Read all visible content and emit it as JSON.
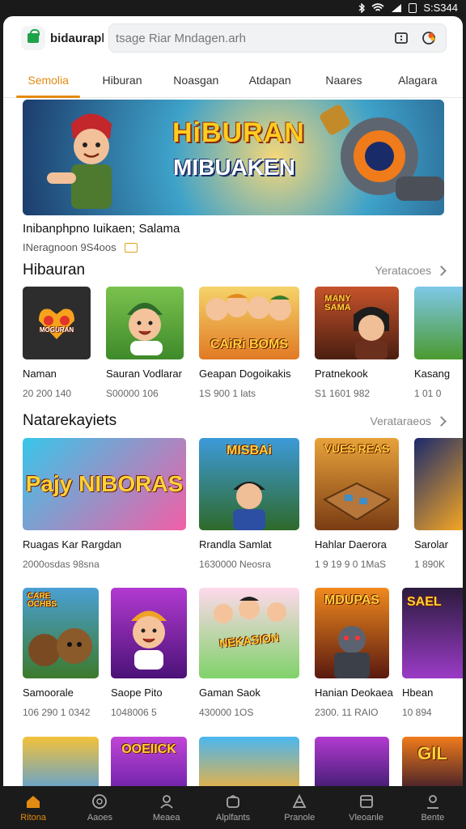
{
  "status_bar": {
    "time": "S:S344"
  },
  "header": {
    "store_name": "bidaurapla",
    "search_value": "tsage Riar Mndagen.arh"
  },
  "tabs": [
    {
      "label": "Semolia",
      "active": true
    },
    {
      "label": "Hiburan",
      "active": false
    },
    {
      "label": "Noasgan",
      "active": false
    },
    {
      "label": "Atdapan",
      "active": false
    },
    {
      "label": "Naares",
      "active": false
    },
    {
      "label": "Alagara",
      "active": false
    }
  ],
  "hero": {
    "title": "HiBURAN",
    "subtitle": "MIBUAKEN",
    "caption": "Inibanphpno Iuikaen; Salama",
    "meta": "INeragnoon 9S4oos"
  },
  "section1": {
    "title": "Hibauran",
    "more": "Yeratacoes",
    "cards": [
      {
        "title": "Naman",
        "meta": "20 200 140",
        "art": "MOGURAN"
      },
      {
        "title": "Sauran Vodlarar",
        "meta": "S00000 106",
        "art": ""
      },
      {
        "title": "Geapan Dogoikakis",
        "meta": "1S 900 1 lats",
        "art": "CAiRi BOMS"
      },
      {
        "title": "Pratnekook",
        "meta": "S1 1601 982",
        "art": "MANY SAMA"
      },
      {
        "title": "Kasang",
        "meta": "1 01 0",
        "art": ""
      }
    ]
  },
  "section2": {
    "title": "Natarekayiets",
    "more": "Verataraeos",
    "cards": [
      {
        "title": "Ruagas Kar Rargdan",
        "meta": "2000osdas 98sna",
        "art": "Pajy NIBORAS"
      },
      {
        "title": "Rrandla Samlat",
        "meta": "1630000 Neosra",
        "art": "MISBAi"
      },
      {
        "title": "Hahlar Daerora",
        "meta": "1 9 19 9 0 1MaS",
        "art": "VUES REAS"
      },
      {
        "title": "Sarolar",
        "meta": "1 890K",
        "art": ""
      }
    ]
  },
  "section3": {
    "cards": [
      {
        "title": "Samoorale",
        "meta": "106 290 1 0342",
        "art": "CARE OCHBS"
      },
      {
        "title": "Saope Pito",
        "meta": "1048006 5",
        "art": ""
      },
      {
        "title": "Gaman Saok",
        "meta": "430000 1OS",
        "art": "NEKASION"
      },
      {
        "title": "Hanian Deokaea",
        "meta": "2300. 11 RAIO",
        "art": "MDUPAS"
      },
      {
        "title": "Hbean",
        "meta": "10 894",
        "art": "SAEL"
      }
    ]
  },
  "section4": {
    "cards": [
      {
        "art": ""
      },
      {
        "art": "OOEIICK"
      },
      {
        "art": ""
      },
      {
        "art": ""
      },
      {
        "art": "GIL"
      }
    ]
  },
  "bottom_nav": [
    {
      "label": "Ritona",
      "icon": "home-icon",
      "active": true
    },
    {
      "label": "Aaoes",
      "icon": "games-icon",
      "active": false
    },
    {
      "label": "Meaea",
      "icon": "profile-icon",
      "active": false
    },
    {
      "label": "Alplfants",
      "icon": "apps-icon",
      "active": false
    },
    {
      "label": "Pranole",
      "icon": "rewards-icon",
      "active": false
    },
    {
      "label": "Vleoanle",
      "icon": "library-icon",
      "active": false
    },
    {
      "label": "Bente",
      "icon": "account-icon",
      "active": false
    }
  ]
}
